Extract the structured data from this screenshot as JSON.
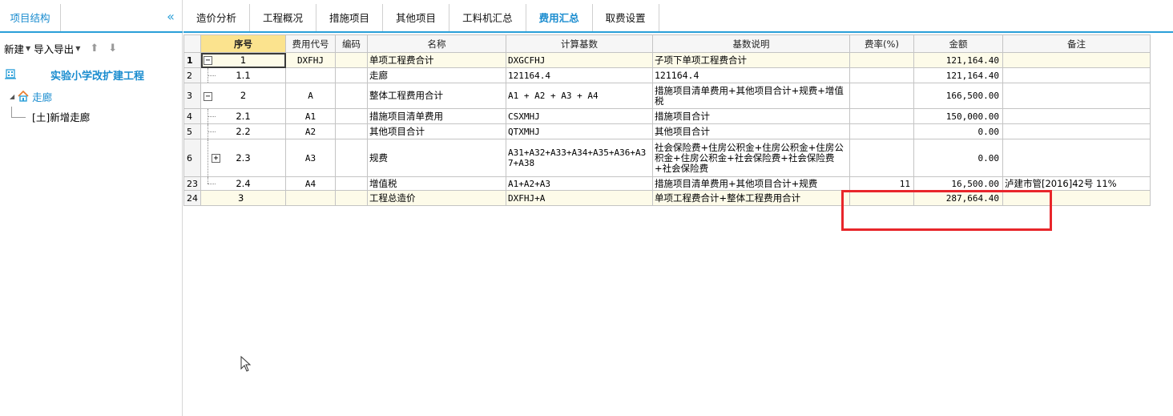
{
  "left_panel": {
    "tab_label": "项目结构",
    "collapse_icon": "double-chevron-left-icon",
    "toolbar": {
      "new_label": "新建",
      "import_export_label": "导入导出",
      "up_icon": "arrow-up-icon",
      "down_icon": "arrow-down-icon"
    },
    "tree": {
      "root_label": "实验小学改扩建工程",
      "node_label": "走廊",
      "leaf_label": "[土]新增走廊"
    }
  },
  "main_tabs": [
    {
      "label": "造价分析"
    },
    {
      "label": "工程概况"
    },
    {
      "label": "措施项目"
    },
    {
      "label": "其他项目"
    },
    {
      "label": "工料机汇总"
    },
    {
      "label": "费用汇总",
      "active": true
    },
    {
      "label": "取费设置"
    }
  ],
  "grid": {
    "headers": {
      "seq": "序号",
      "code": "费用代号",
      "num": "编码",
      "name": "名称",
      "base": "计算基数",
      "base_desc": "基数说明",
      "rate": "费率(%)",
      "amount": "金额",
      "note": "备注"
    },
    "rows": [
      {
        "rownum": "1",
        "seq": "1",
        "code": "DXFHJ",
        "num": "",
        "name": "单项工程费合计",
        "base": "DXGCFHJ",
        "base_desc": "子项下单项工程费合计",
        "rate": "",
        "amount": "121,164.40",
        "note": ""
      },
      {
        "rownum": "2",
        "seq": "1.1",
        "code": "",
        "num": "",
        "name": "走廊",
        "base": "121164.4",
        "base_desc": "121164.4",
        "rate": "",
        "amount": "121,164.40",
        "note": ""
      },
      {
        "rownum": "3",
        "seq": "2",
        "code": "A",
        "num": "",
        "name": "整体工程费用合计",
        "base": "A1 + A2 + A3 + A4",
        "base_desc": "措施项目清单费用+其他项目合计+规费+增值税",
        "rate": "",
        "amount": "166,500.00",
        "note": ""
      },
      {
        "rownum": "4",
        "seq": "2.1",
        "code": "A1",
        "num": "",
        "name": "措施项目清单费用",
        "base": "CSXMHJ",
        "base_desc": "措施项目合计",
        "rate": "",
        "amount": "150,000.00",
        "note": ""
      },
      {
        "rownum": "5",
        "seq": "2.2",
        "code": "A2",
        "num": "",
        "name": "其他项目合计",
        "base": "QTXMHJ",
        "base_desc": "其他项目合计",
        "rate": "",
        "amount": "0.00",
        "note": ""
      },
      {
        "rownum": "6",
        "seq": "2.3",
        "code": "A3",
        "num": "",
        "name": "规费",
        "base": "A31+A32+A33+A34+A35+A36+A37+A38",
        "base_desc": "社会保险费+住房公积金+住房公积金+住房公积金+住房公积金+社会保险费+社会保险费+社会保险费",
        "rate": "",
        "amount": "0.00",
        "note": ""
      },
      {
        "rownum": "23",
        "seq": "2.4",
        "code": "A4",
        "num": "",
        "name": "增值税",
        "base": "A1+A2+A3",
        "base_desc": "措施项目清单费用+其他项目合计+规费",
        "rate": "11",
        "amount": "16,500.00",
        "note": "泸建市管[2016]42号 11%"
      },
      {
        "rownum": "24",
        "seq": "3",
        "code": "",
        "num": "",
        "name": "工程总造价",
        "base": "DXFHJ+A",
        "base_desc": "单项工程费合计+整体工程费用合计",
        "rate": "",
        "amount": "287,664.40",
        "note": ""
      }
    ]
  },
  "icons": {
    "root": "building-icon",
    "node": "home-icon",
    "expand": "plus-box-icon",
    "collapse": "minus-box-icon",
    "cursor": "mouse-pointer-icon"
  },
  "colors": {
    "accent": "#2a9fd8",
    "highlight_box": "#e8262b",
    "selected_header": "#fbe38e",
    "row_highlight": "#fdfbe9"
  }
}
